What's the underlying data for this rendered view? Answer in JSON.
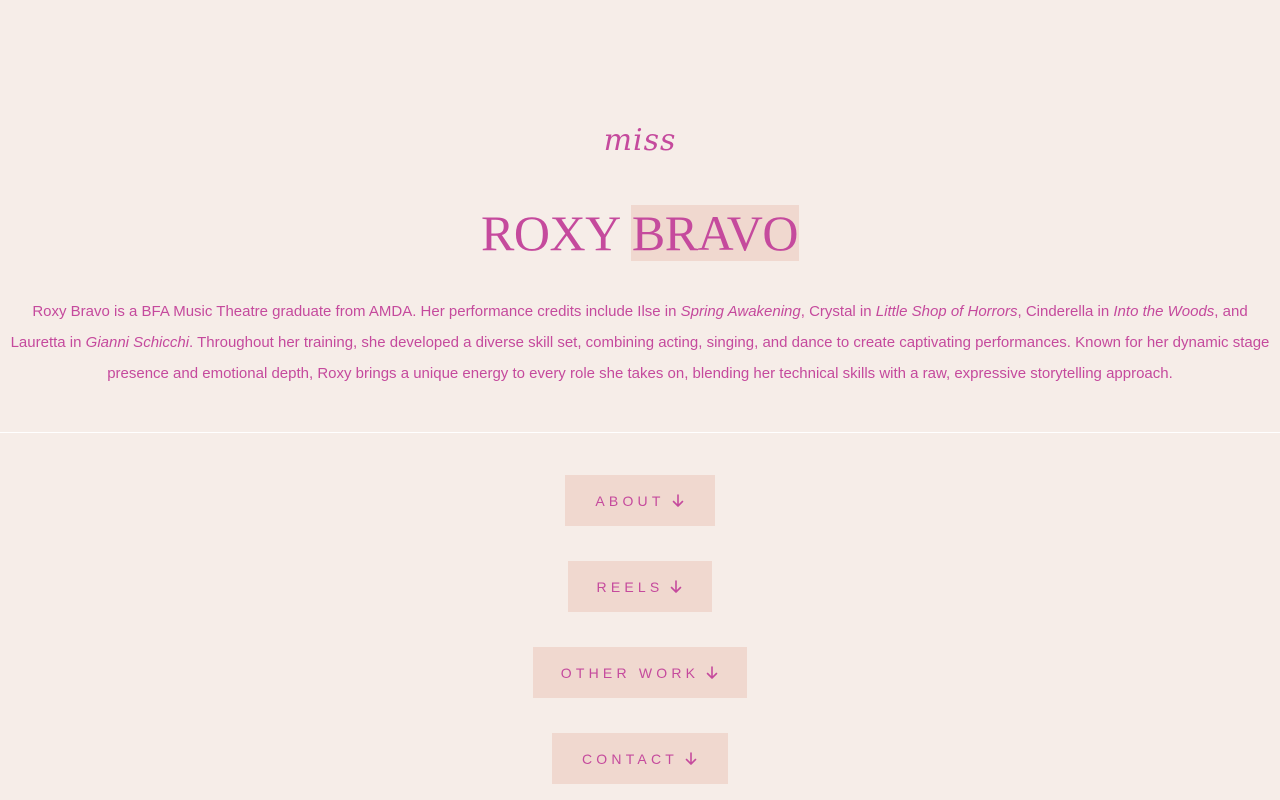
{
  "hero": {
    "script_text": "miss",
    "title_first": "ROXY",
    "title_second": "BRAVO",
    "bio": {
      "t1": "Roxy Bravo is a BFA Music Theatre graduate from AMDA. Her performance credits include Ilse in ",
      "i1": "Spring Awakening",
      "t2": ", Crystal in ",
      "i2": "Little Shop of Horrors",
      "t3": ", Cinderella in ",
      "i3": "Into the Woods",
      "t4": ", and Lauretta in ",
      "i4": "Gianni Schicchi",
      "t5": ". Throughout her training, she developed a diverse skill set, combining acting, singing, and dance to create captivating performances. Known for her dynamic stage presence and emotional depth, Roxy brings a unique energy to every role she takes on, blending her technical skills with a raw, expressive storytelling approach."
    }
  },
  "nav": {
    "about": "ABOUT",
    "reels": "REELS",
    "other_work": "OTHER WORK",
    "contact": "CONTACT",
    "arrow_icon": "arrow-down-icon"
  },
  "colors": {
    "background": "#f6ede8",
    "accent": "#c54a9d",
    "button_bg": "#f0d8cf"
  }
}
